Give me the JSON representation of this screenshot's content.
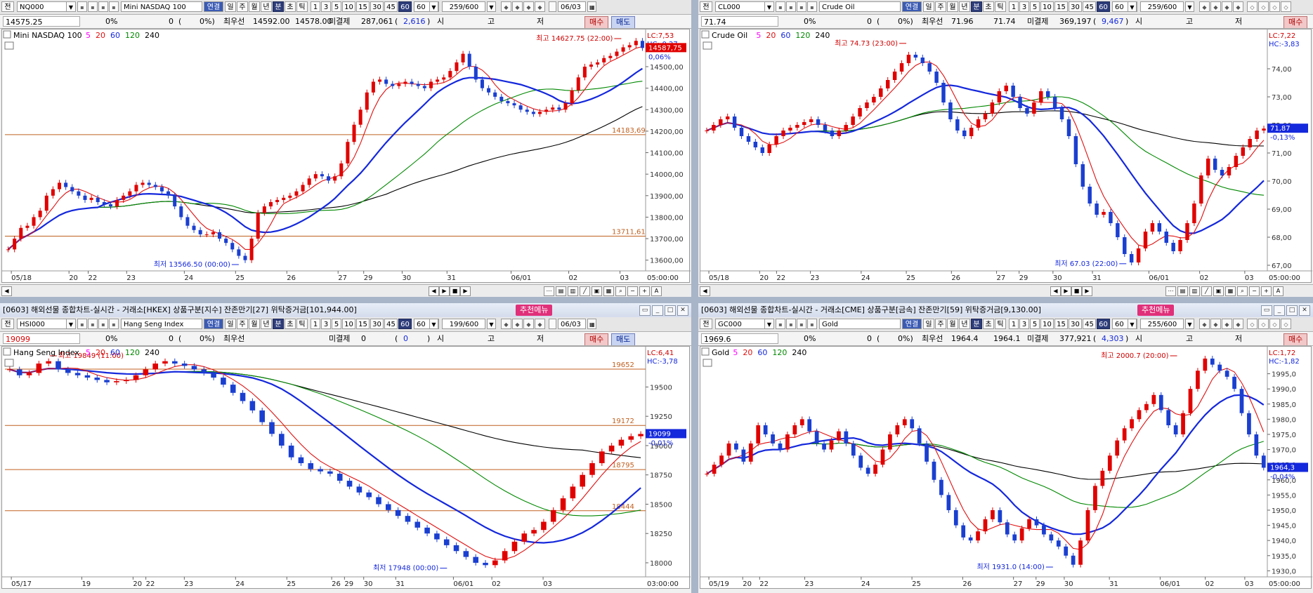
{
  "panels": {
    "tl": {
      "title": "",
      "code": "NQ000",
      "name": "Mini NASDAQ 100",
      "count": "259/600",
      "date": "06/03",
      "info": {
        "price": "14575.25",
        "pct": "0%",
        "vol": "0",
        "vpct": "0%)",
        "last_label": "최우선",
        "bid": "14592.00",
        "ask": "14578.00",
        "oi_label": "미결제",
        "oi": "287,061",
        "oi_chg": "2,616",
        "o": "시",
        "h": "고",
        "l": "저"
      },
      "legend": {
        "name": "Mini NASDAQ 100",
        "ma": [
          "5",
          "20",
          "60",
          "120",
          "240"
        ]
      },
      "right_labels": {
        "lc": "LC:7,53",
        "hc": "HC:-0,27",
        "price": "14587,75",
        "pct": "0,06%"
      }
    },
    "tr": {
      "title": "",
      "code": "CL000",
      "name": "Crude Oil",
      "count": "259/600",
      "date": "",
      "info": {
        "price": "71.74",
        "pct": "0%",
        "vol": "0",
        "vpct": "0%)",
        "last_label": "최우선",
        "bid": "71.96",
        "ask": "71.74",
        "oi_label": "미결제",
        "oi": "369,197",
        "oi_chg": "9,467",
        "o": "시",
        "h": "고",
        "l": "저"
      },
      "legend": {
        "name": "Crude Oil",
        "ma": [
          "5",
          "20",
          "60",
          "120",
          "240"
        ]
      },
      "right_labels": {
        "lc": "LC:7,22",
        "hc": "HC:-3,83",
        "price": "71,87",
        "pct": "-0,13%"
      }
    },
    "bl": {
      "title": "[0603] 해외선물 종합차트-실시간 - 거래소[HKEX] 상품구분[지수] 잔존만기[27] 위탁증거금[101,944.00]",
      "code": "HSI000",
      "name": "Hang Seng Index",
      "count": "199/600",
      "date": "06/03",
      "info": {
        "price": "19099",
        "pct": "0%",
        "vol": "0",
        "vpct": "0%)",
        "last_label": "최우선",
        "bid": "",
        "ask": "",
        "oi_label": "미결제",
        "oi": "0",
        "oi_chg": "0",
        "o": "시",
        "h": "고",
        "l": "저"
      },
      "legend": {
        "name": "Hang Seng Index",
        "ma": [
          "5",
          "20",
          "60",
          "120",
          "240"
        ]
      },
      "right_labels": {
        "lc": "LC:6,41",
        "hc": "HC:-3,78",
        "price": "19099",
        "pct": "-0,01%"
      }
    },
    "br": {
      "title": "[0603] 해외선물 종합차트-실시간 - 거래소[CME] 상품구분[금속] 잔존만기[59] 위탁증거금[9,130.00]",
      "code": "GC000",
      "name": "Gold",
      "count": "255/600",
      "date": "",
      "info": {
        "price": "1969.6",
        "pct": "0%",
        "vol": "0",
        "vpct": "0%)",
        "last_label": "최우선",
        "bid": "1964.4",
        "ask": "1964.1",
        "oi_label": "미결제",
        "oi": "377,921",
        "oi_chg": "4,303",
        "o": "시",
        "h": "고",
        "l": "저"
      },
      "legend": {
        "name": "Gold",
        "ma": [
          "5",
          "20",
          "60",
          "120",
          "240"
        ]
      },
      "right_labels": {
        "lc": "LC:1,72",
        "hc": "HC:-1,82",
        "price": "1964,3",
        "pct": "-0,04%"
      }
    }
  },
  "ui": {
    "recommend": "추천메뉴",
    "buy": "매수",
    "sell": "매도",
    "jeon": "전",
    "link": "연결",
    "periods": [
      "일",
      "주",
      "월",
      "년",
      "분",
      "초",
      "틱"
    ],
    "active_period": "분",
    "intervals": [
      "1",
      "3",
      "5",
      "10",
      "15",
      "30",
      "45",
      "60"
    ],
    "active_interval": "60",
    "interval_select": "60"
  },
  "colors": {
    "candle_up": "#e00000",
    "candle_down": "#1a3fd0",
    "ma5": "#ff00ff",
    "ma20": "#e01010",
    "ma60": "#1428dc",
    "ma120": "#008800",
    "ma240": "#000000",
    "hline": "#c06020",
    "price_box": "#e00000",
    "price_box_blue": "#1428dc"
  },
  "chart_data": [
    {
      "type": "candlestick",
      "title": "Mini NASDAQ 100",
      "ylim": [
        13550,
        14660
      ],
      "yticks": [
        "14500,00",
        "14400,00",
        "14300,00",
        "14200,00",
        "14100,00",
        "14000,00",
        "13900,00",
        "13800,00",
        "13700,00",
        "13600,00"
      ],
      "ytick_values": [
        14500,
        14400,
        14300,
        14200,
        14100,
        14000,
        13900,
        13800,
        13700,
        13600
      ],
      "xticks": [
        "05/18",
        "20",
        "22",
        "23",
        "24",
        "25",
        "26",
        "27",
        "29",
        "30",
        "31",
        "06/01",
        "02",
        "03"
      ],
      "xtick_pos": [
        0.01,
        0.1,
        0.13,
        0.19,
        0.28,
        0.36,
        0.44,
        0.52,
        0.56,
        0.62,
        0.69,
        0.79,
        0.88,
        0.96
      ],
      "xaxis_end": "05:00:00",
      "hlines": [
        {
          "value": 14183.69,
          "label": "14183,69"
        },
        {
          "value": 13711.61,
          "label": "13711,61"
        }
      ],
      "annotations": [
        {
          "text": "최고 14627.75 (22:00)",
          "x": 0.962,
          "y": 14627.75,
          "side": "left"
        },
        {
          "text": "최저 13566.50 (00:00)",
          "x": 0.365,
          "y": 13566.5,
          "side": "left"
        }
      ],
      "close": [
        13650,
        13700,
        13750,
        13760,
        13800,
        13830,
        13900,
        13930,
        13960,
        13940,
        13920,
        13900,
        13880,
        13890,
        13870,
        13860,
        13850,
        13880,
        13900,
        13920,
        13950,
        13960,
        13950,
        13940,
        13920,
        13900,
        13850,
        13800,
        13760,
        13740,
        13720,
        13720,
        13730,
        13700,
        13680,
        13650,
        13620,
        13600,
        13700,
        13820,
        13850,
        13870,
        13880,
        13890,
        13900,
        13920,
        13950,
        13980,
        14000,
        13990,
        13970,
        13990,
        14050,
        14150,
        14230,
        14300,
        14380,
        14430,
        14440,
        14420,
        14410,
        14420,
        14430,
        14420,
        14410,
        14400,
        14430,
        14440,
        14450,
        14480,
        14520,
        14560,
        14500,
        14440,
        14400,
        14380,
        14360,
        14340,
        14330,
        14320,
        14300,
        14290,
        14280,
        14290,
        14300,
        14310,
        14300,
        14330,
        14390,
        14450,
        14500,
        14510,
        14520,
        14540,
        14550,
        14570,
        14590,
        14600,
        14620,
        14587
      ]
    },
    {
      "type": "candlestick",
      "title": "Crude Oil",
      "ylim": [
        66.8,
        75.3
      ],
      "yticks": [
        "74,00",
        "73,00",
        "72,00",
        "71,00",
        "70,00",
        "69,00",
        "68,00",
        "67,00"
      ],
      "ytick_values": [
        74,
        73,
        72,
        71,
        70,
        69,
        68,
        67
      ],
      "xticks": [
        "05/18",
        "20",
        "22",
        "23",
        "24",
        "25",
        "26",
        "27",
        "29",
        "30",
        "31",
        "06/01",
        "02",
        "03"
      ],
      "xtick_pos": [
        0.01,
        0.1,
        0.13,
        0.19,
        0.28,
        0.36,
        0.44,
        0.52,
        0.56,
        0.62,
        0.69,
        0.79,
        0.88,
        0.96
      ],
      "xaxis_end": "05:00:00",
      "hlines": [],
      "annotations": [
        {
          "text": "최고 74.73 (23:00)",
          "x": 0.36,
          "y": 74.73,
          "side": "left"
        },
        {
          "text": "최저 67.03 (22:00)",
          "x": 0.75,
          "y": 67.03,
          "side": "left"
        }
      ],
      "close": [
        71.8,
        72.0,
        72.2,
        72.3,
        71.9,
        71.6,
        71.4,
        71.2,
        71.0,
        71.3,
        71.6,
        71.8,
        71.9,
        72.0,
        72.1,
        72.2,
        72.0,
        71.8,
        71.6,
        71.8,
        72.0,
        72.3,
        72.6,
        72.8,
        73.0,
        73.3,
        73.6,
        73.9,
        74.2,
        74.5,
        74.4,
        74.2,
        73.9,
        73.5,
        72.8,
        72.2,
        71.8,
        71.6,
        71.9,
        72.2,
        72.4,
        72.8,
        73.2,
        73.4,
        73.0,
        72.6,
        72.4,
        72.8,
        73.2,
        73.0,
        72.6,
        72.2,
        71.6,
        70.6,
        69.8,
        69.2,
        68.8,
        68.9,
        68.5,
        68.0,
        67.4,
        67.1,
        67.6,
        68.2,
        68.5,
        68.2,
        67.8,
        67.5,
        67.9,
        68.5,
        69.2,
        70.2,
        70.8,
        70.4,
        70.2,
        70.5,
        70.9,
        71.2,
        71.5,
        71.8,
        71.87
      ]
    },
    {
      "type": "candlestick",
      "title": "Hang Seng Index",
      "ylim": [
        17880,
        19820
      ],
      "yticks": [
        "19750",
        "19500",
        "19250",
        "19000",
        "18750",
        "18500",
        "18250",
        "18000"
      ],
      "ytick_values": [
        19750,
        19500,
        19250,
        19000,
        18750,
        18500,
        18250,
        18000
      ],
      "xticks": [
        "05/17",
        "19",
        "20",
        "22",
        "23",
        "24",
        "25",
        "26",
        "29",
        "30",
        "31",
        "06/01",
        "02",
        "03"
      ],
      "xtick_pos": [
        0.01,
        0.12,
        0.2,
        0.22,
        0.28,
        0.36,
        0.44,
        0.51,
        0.53,
        0.56,
        0.61,
        0.7,
        0.76,
        0.84
      ],
      "xaxis_end": "03:00:00",
      "hlines": [
        {
          "value": 19652,
          "label": "19652"
        },
        {
          "value": 19172,
          "label": "19172"
        },
        {
          "value": 18795,
          "label": "18795"
        },
        {
          "value": 18444,
          "label": "18444"
        }
      ],
      "annotations": [
        {
          "text": "최고 19849 (11:00)",
          "x": 0.07,
          "y": 19780,
          "side": "right"
        },
        {
          "text": "최저 17948 (00:00)",
          "x": 0.69,
          "y": 17948,
          "side": "left"
        }
      ],
      "close": [
        19650,
        19600,
        19620,
        19700,
        19720,
        19650,
        19620,
        19600,
        19580,
        19560,
        19540,
        19550,
        19560,
        19600,
        19650,
        19700,
        19720,
        19700,
        19680,
        19650,
        19620,
        19580,
        19520,
        19450,
        19380,
        19300,
        19200,
        19100,
        19000,
        18900,
        18850,
        18800,
        18780,
        18760,
        18700,
        18650,
        18600,
        18560,
        18500,
        18450,
        18400,
        18350,
        18300,
        18250,
        18200,
        18150,
        18100,
        18050,
        18000,
        17980,
        18020,
        18100,
        18180,
        18250,
        18280,
        18350,
        18450,
        18550,
        18650,
        18750,
        18850,
        18950,
        19000,
        19050,
        19080,
        19099
      ]
    },
    {
      "type": "candlestick",
      "title": "Gold",
      "ylim": [
        1928,
        2003
      ],
      "yticks": [
        "1995,0",
        "1990,0",
        "1985,0",
        "1980,0",
        "1975,0",
        "1970,0",
        "1965,0",
        "1960,0",
        "1955,0",
        "1950,0",
        "1945,0",
        "1940,0",
        "1935,0",
        "1930,0"
      ],
      "ytick_values": [
        1995,
        1990,
        1985,
        1980,
        1975,
        1970,
        1965,
        1960,
        1955,
        1950,
        1945,
        1940,
        1935,
        1930
      ],
      "xticks": [
        "05/19",
        "20",
        "22",
        "23",
        "24",
        "25",
        "26",
        "27",
        "29",
        "30",
        "31",
        "06/01",
        "02",
        "03"
      ],
      "xtick_pos": [
        0.01,
        0.07,
        0.1,
        0.18,
        0.28,
        0.37,
        0.46,
        0.55,
        0.59,
        0.64,
        0.72,
        0.81,
        0.89,
        0.96
      ],
      "xaxis_end": "05:00:00",
      "hlines": [],
      "annotations": [
        {
          "text": "최고 2000.7 (20:00)",
          "x": 0.84,
          "y": 2000.7,
          "side": "left"
        },
        {
          "text": "최저 1931.0 (14:00)",
          "x": 0.62,
          "y": 1931,
          "side": "left"
        }
      ],
      "close": [
        1962,
        1965,
        1968,
        1972,
        1970,
        1966,
        1972,
        1978,
        1975,
        1972,
        1970,
        1975,
        1978,
        1980,
        1976,
        1972,
        1970,
        1973,
        1976,
        1972,
        1968,
        1964,
        1962,
        1965,
        1970,
        1975,
        1978,
        1980,
        1977,
        1972,
        1966,
        1960,
        1955,
        1950,
        1945,
        1941,
        1940,
        1943,
        1947,
        1950,
        1946,
        1942,
        1940,
        1944,
        1947,
        1945,
        1942,
        1940,
        1938,
        1935,
        1932,
        1940,
        1950,
        1958,
        1963,
        1968,
        1973,
        1977,
        1980,
        1983,
        1985,
        1988,
        1983,
        1978,
        1975,
        1982,
        1990,
        1996,
        2000,
        1998,
        1996,
        1994,
        1990,
        1982,
        1975,
        1968,
        1964
      ]
    }
  ]
}
